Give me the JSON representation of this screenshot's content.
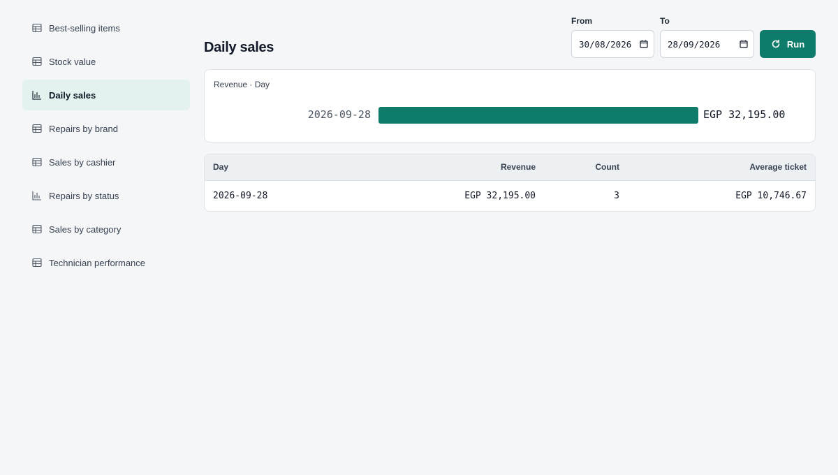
{
  "sidebar": {
    "items": [
      {
        "label": "Best-selling items",
        "icon": "table-icon"
      },
      {
        "label": "Stock value",
        "icon": "table-icon"
      },
      {
        "label": "Daily sales",
        "icon": "bar-chart-icon",
        "active": true
      },
      {
        "label": "Repairs by brand",
        "icon": "table-icon"
      },
      {
        "label": "Sales by cashier",
        "icon": "table-icon"
      },
      {
        "label": "Repairs by status",
        "icon": "bar-chart-icon"
      },
      {
        "label": "Sales by category",
        "icon": "table-icon"
      },
      {
        "label": "Technician performance",
        "icon": "table-icon"
      }
    ]
  },
  "header": {
    "title": "Daily sales",
    "from_label": "From",
    "from_value": "30/08/2026",
    "to_label": "To",
    "to_value": "28/09/2026",
    "run_label": "Run"
  },
  "colors": {
    "accent": "#0f7c6b",
    "active_bg": "#e3f2ee",
    "page_bg": "#f4f6f8"
  },
  "chart_data": {
    "type": "bar",
    "caption": "Revenue · Day",
    "categories": [
      "2026-09-28"
    ],
    "values": [
      32195.0
    ],
    "value_labels": [
      "EGP 32,195.00"
    ],
    "max": 32195.0
  },
  "table": {
    "columns": [
      "Day",
      "Revenue",
      "Count",
      "Average ticket"
    ],
    "rows": [
      [
        "2026-09-28",
        "EGP 32,195.00",
        "3",
        "EGP 10,746.67"
      ]
    ]
  }
}
